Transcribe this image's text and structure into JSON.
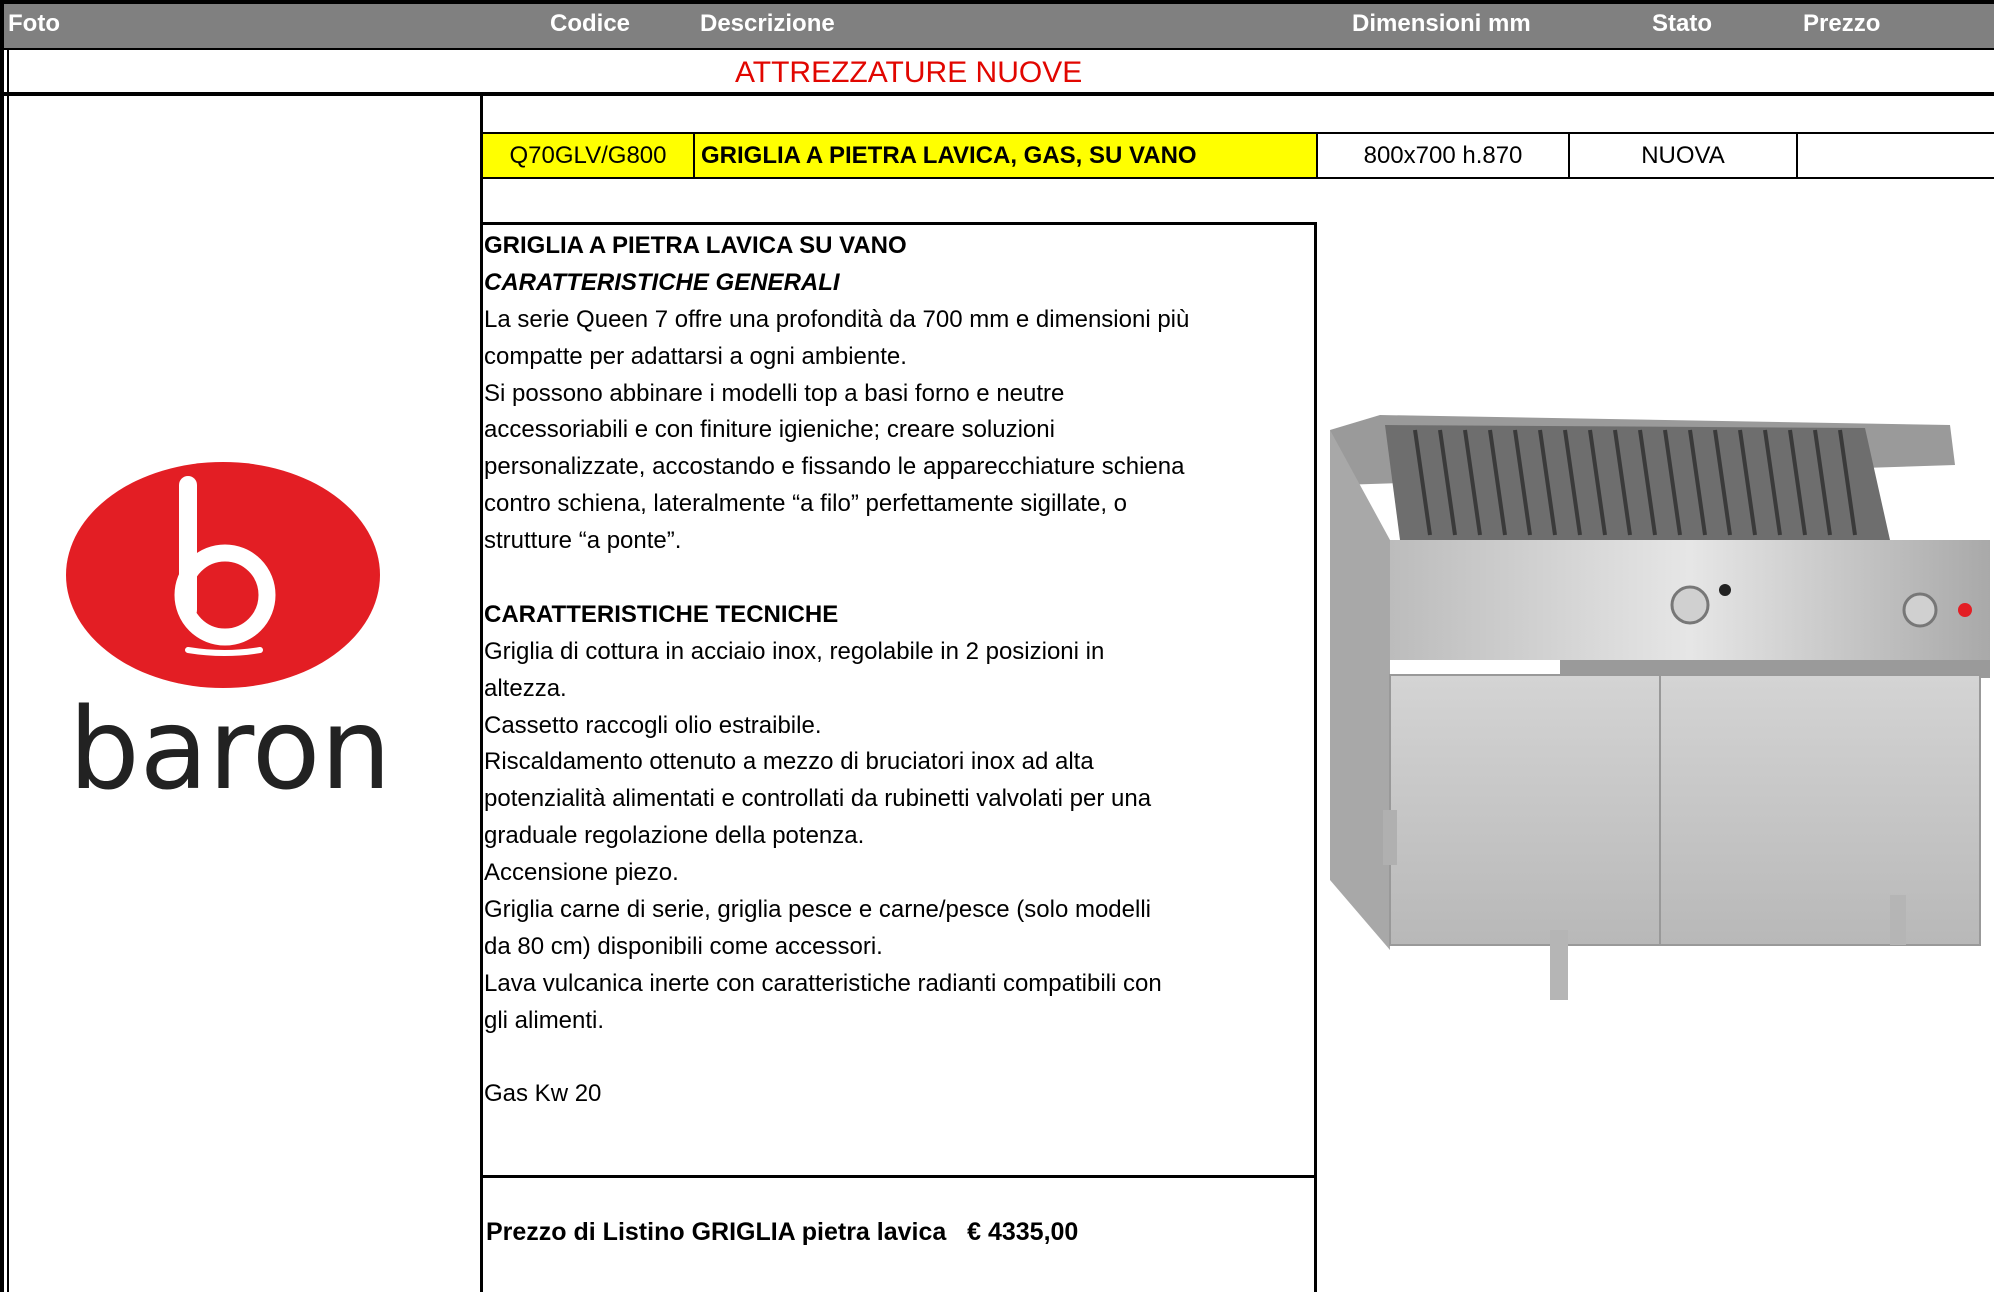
{
  "header": {
    "col_foto": "Foto",
    "col_codice": "Codice",
    "col_descrizione": "Descrizione",
    "col_dimensioni": "Dimensioni mm",
    "col_stato": "Stato",
    "col_prezzo": "Prezzo"
  },
  "section_title": "ATTREZZATURE NUOVE",
  "product": {
    "code": "Q70GLV/G800",
    "name": "GRIGLIA A PIETRA LAVICA, GAS, SU VANO",
    "dimensions": "800x700 h.870",
    "state": "NUOVA",
    "price": ""
  },
  "description": {
    "heading": "GRIGLIA A PIETRA LAVICA SU VANO",
    "subheading": "CARATTERISTICHE GENERALI",
    "general_lines": [
      "La serie Queen 7 offre una profondità da 700 mm e dimensioni più",
      "compatte per adattarsi a ogni ambiente.",
      "Si possono abbinare i modelli top a basi forno e neutre",
      "accessoriabili e con finiture igieniche; creare soluzioni",
      "personalizzate, accostando e fissando le apparecchiature schiena",
      "contro schiena, lateralmente “a filo” perfettamente sigillate, o",
      "strutture “a ponte”."
    ],
    "tech_heading": "CARATTERISTICHE TECNICHE",
    "tech_lines": [
      "Griglia di cottura in acciaio inox, regolabile in 2 posizioni in",
      "altezza.",
      "Cassetto raccogli olio estraibile.",
      "Riscaldamento ottenuto a mezzo di bruciatori inox ad alta",
      "potenzialità alimentati e controllati da rubinetti valvolati per una",
      "graduale regolazione della potenza.",
      "Accensione piezo.",
      "Griglia carne di serie, griglia pesce e carne/pesce (solo modelli",
      "da 80 cm) disponibili come accessori.",
      "Lava vulcanica inerte con caratteristiche radianti compatibili con",
      "gli alimenti."
    ],
    "power": "Gas Kw 20"
  },
  "list_price": "Prezzo di Listino GRIGLIA pietra lavica   € 4335,00",
  "logo": {
    "word": "baron",
    "color": "#e31e24"
  },
  "colors": {
    "header_bg": "#808080",
    "title_red": "#e10600",
    "highlight_yellow": "#ffff00"
  }
}
